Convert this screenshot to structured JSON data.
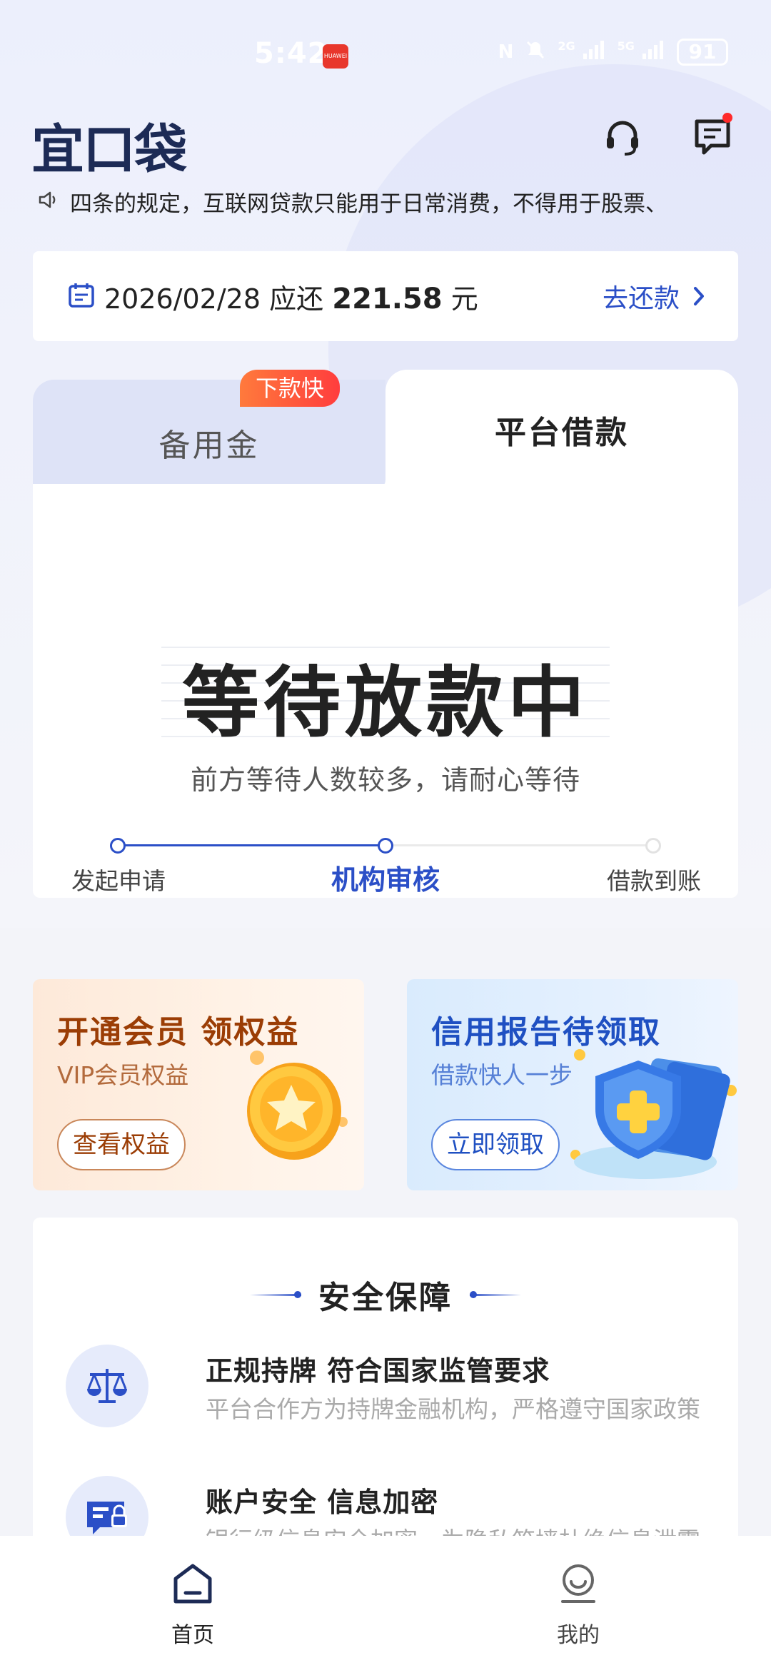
{
  "status_bar": {
    "time": "5:42",
    "app_badge": "HUAWEI",
    "nfc": "N",
    "signal_1": "2G",
    "signal_2": "5G",
    "battery": "91"
  },
  "header": {
    "logo": "宜口袋",
    "support_icon": "headset-icon",
    "message_icon": "message-icon",
    "message_has_unread": true
  },
  "notice": {
    "icon": "speaker-icon",
    "text": "四条的规定，互联网贷款只能用于日常消费，不得用于股票、"
  },
  "repay": {
    "icon": "calendar-icon",
    "date": "2026/02/28",
    "due_label": "应还",
    "amount": "221.58",
    "unit": "元",
    "action": "去还款"
  },
  "loan_card": {
    "tabs": [
      {
        "label": "备用金",
        "badge": "下款快",
        "active": false
      },
      {
        "label": "平台借款",
        "active": true
      }
    ],
    "status_title": "等待放款中",
    "status_subtitle": "前方等待人数较多，请耐心等待",
    "steps": [
      {
        "label": "发起申请",
        "state": "done"
      },
      {
        "label": "机构审核",
        "state": "current"
      },
      {
        "label": "借款到账",
        "state": "todo"
      }
    ]
  },
  "promos": [
    {
      "title": "开通会员 领权益",
      "subtitle": "VIP会员权益",
      "button": "查看权益",
      "art": "gold-star-coin-icon"
    },
    {
      "title": "信用报告待领取",
      "subtitle": "借款快人一步",
      "button": "立即领取",
      "art": "shield-document-icon"
    }
  ],
  "security": {
    "title": "安全保障",
    "items": [
      {
        "icon": "balance-scale-icon",
        "title": "正规持牌 符合国家监管要求",
        "desc": "平台合作方为持牌金融机构，严格遵守国家政策"
      },
      {
        "icon": "secure-card-icon",
        "title": "账户安全 信息加密",
        "desc": "银行级信息安全加密，为隐私筑墙杜绝信息泄露"
      }
    ]
  },
  "bottom_nav": [
    {
      "label": "首页",
      "icon": "home-icon",
      "active": true
    },
    {
      "label": "我的",
      "icon": "profile-icon",
      "active": false
    }
  ],
  "colors": {
    "accent": "#2b4fc7",
    "logo": "#1d2b56",
    "badge": "#ff4a35",
    "vip_text": "#9b3d05"
  }
}
